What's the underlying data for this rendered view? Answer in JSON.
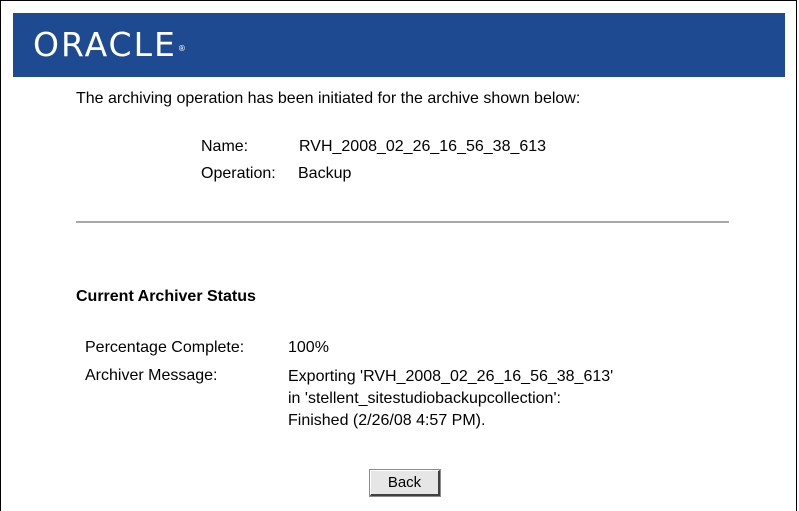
{
  "header": {
    "logo_text": "ORACLE",
    "logo_mark": "®",
    "banner_color": "#1d4a91"
  },
  "intro": "The archiving operation has been initiated for the archive shown below:",
  "archive": {
    "name_label": "Name:",
    "name_value": "RVH_2008_02_26_16_56_38_613",
    "operation_label": "Operation:",
    "operation_value": "Backup"
  },
  "status": {
    "heading": "Current Archiver Status",
    "percentage_label": "Percentage Complete:",
    "percentage_value": "100%",
    "message_label": "Archiver Message:",
    "message_lines": [
      "Exporting 'RVH_2008_02_26_16_56_38_613'",
      "in 'stellent_sitestudiobackupcollection':",
      "Finished (2/26/08 4:57 PM)."
    ]
  },
  "buttons": {
    "back_label": "Back"
  }
}
